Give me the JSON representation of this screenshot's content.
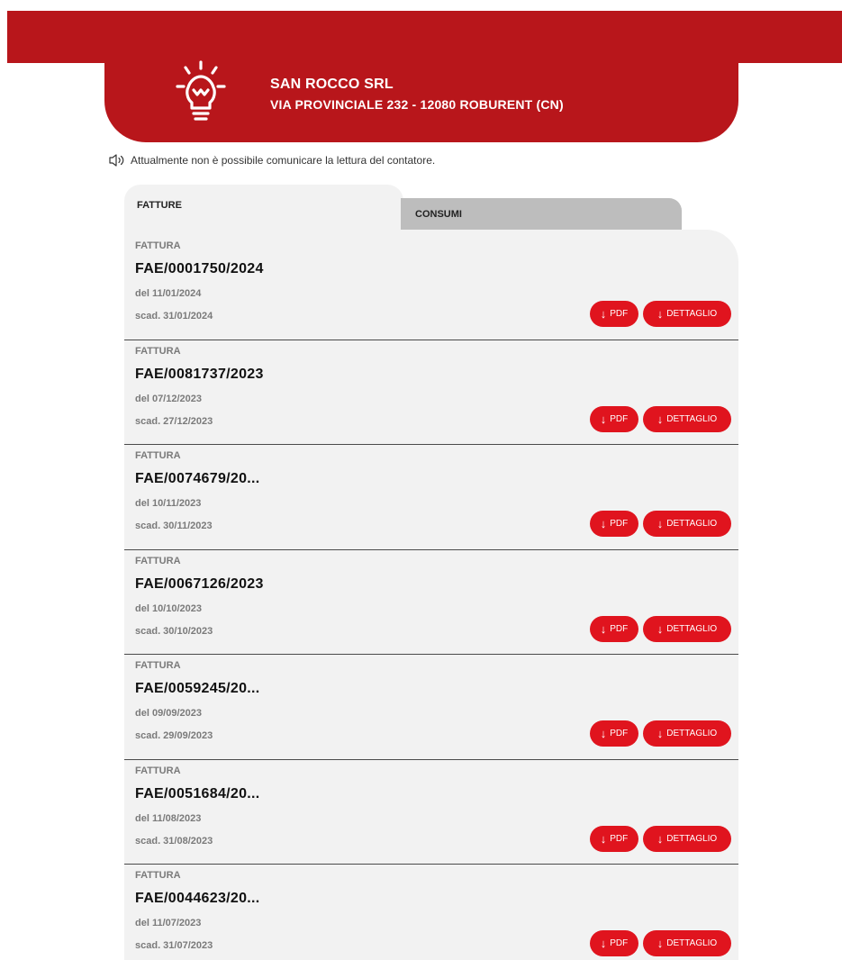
{
  "header": {
    "company_name": "SAN ROCCO SRL",
    "address": "VIA PROVINCIALE 232 - 12080 ROBURENT (CN)",
    "icon": "lightbulb-icon",
    "brand_color": "#b8161b"
  },
  "notice": {
    "text": "Attualmente non è possibile comunicare la lettura del contatore.",
    "icon": "speaker-icon"
  },
  "tabs": [
    {
      "label": "FATTURE",
      "active": true
    },
    {
      "label": "CONSUMI",
      "active": false
    }
  ],
  "buttons": {
    "pdf_label": "PDF",
    "detail_label": "DETTAGLIO",
    "arrow": "↓",
    "color": "#e0141e"
  },
  "invoices": [
    {
      "type": "FATTURA",
      "number": "FAE/0001750/2024",
      "date": "del 11/01/2024",
      "due": "scad. 31/01/2024"
    },
    {
      "type": "FATTURA",
      "number": "FAE/0081737/2023",
      "date": "del 07/12/2023",
      "due": "scad. 27/12/2023"
    },
    {
      "type": "FATTURA",
      "number": "FAE/0074679/20...",
      "date": "del 10/11/2023",
      "due": "scad. 30/11/2023"
    },
    {
      "type": "FATTURA",
      "number": "FAE/0067126/2023",
      "date": "del 10/10/2023",
      "due": "scad. 30/10/2023"
    },
    {
      "type": "FATTURA",
      "number": "FAE/0059245/20...",
      "date": "del 09/09/2023",
      "due": "scad. 29/09/2023"
    },
    {
      "type": "FATTURA",
      "number": "FAE/0051684/20...",
      "date": "del 11/08/2023",
      "due": "scad. 31/08/2023"
    },
    {
      "type": "FATTURA",
      "number": "FAE/0044623/20...",
      "date": "del 11/07/2023",
      "due": "scad. 31/07/2023"
    }
  ]
}
